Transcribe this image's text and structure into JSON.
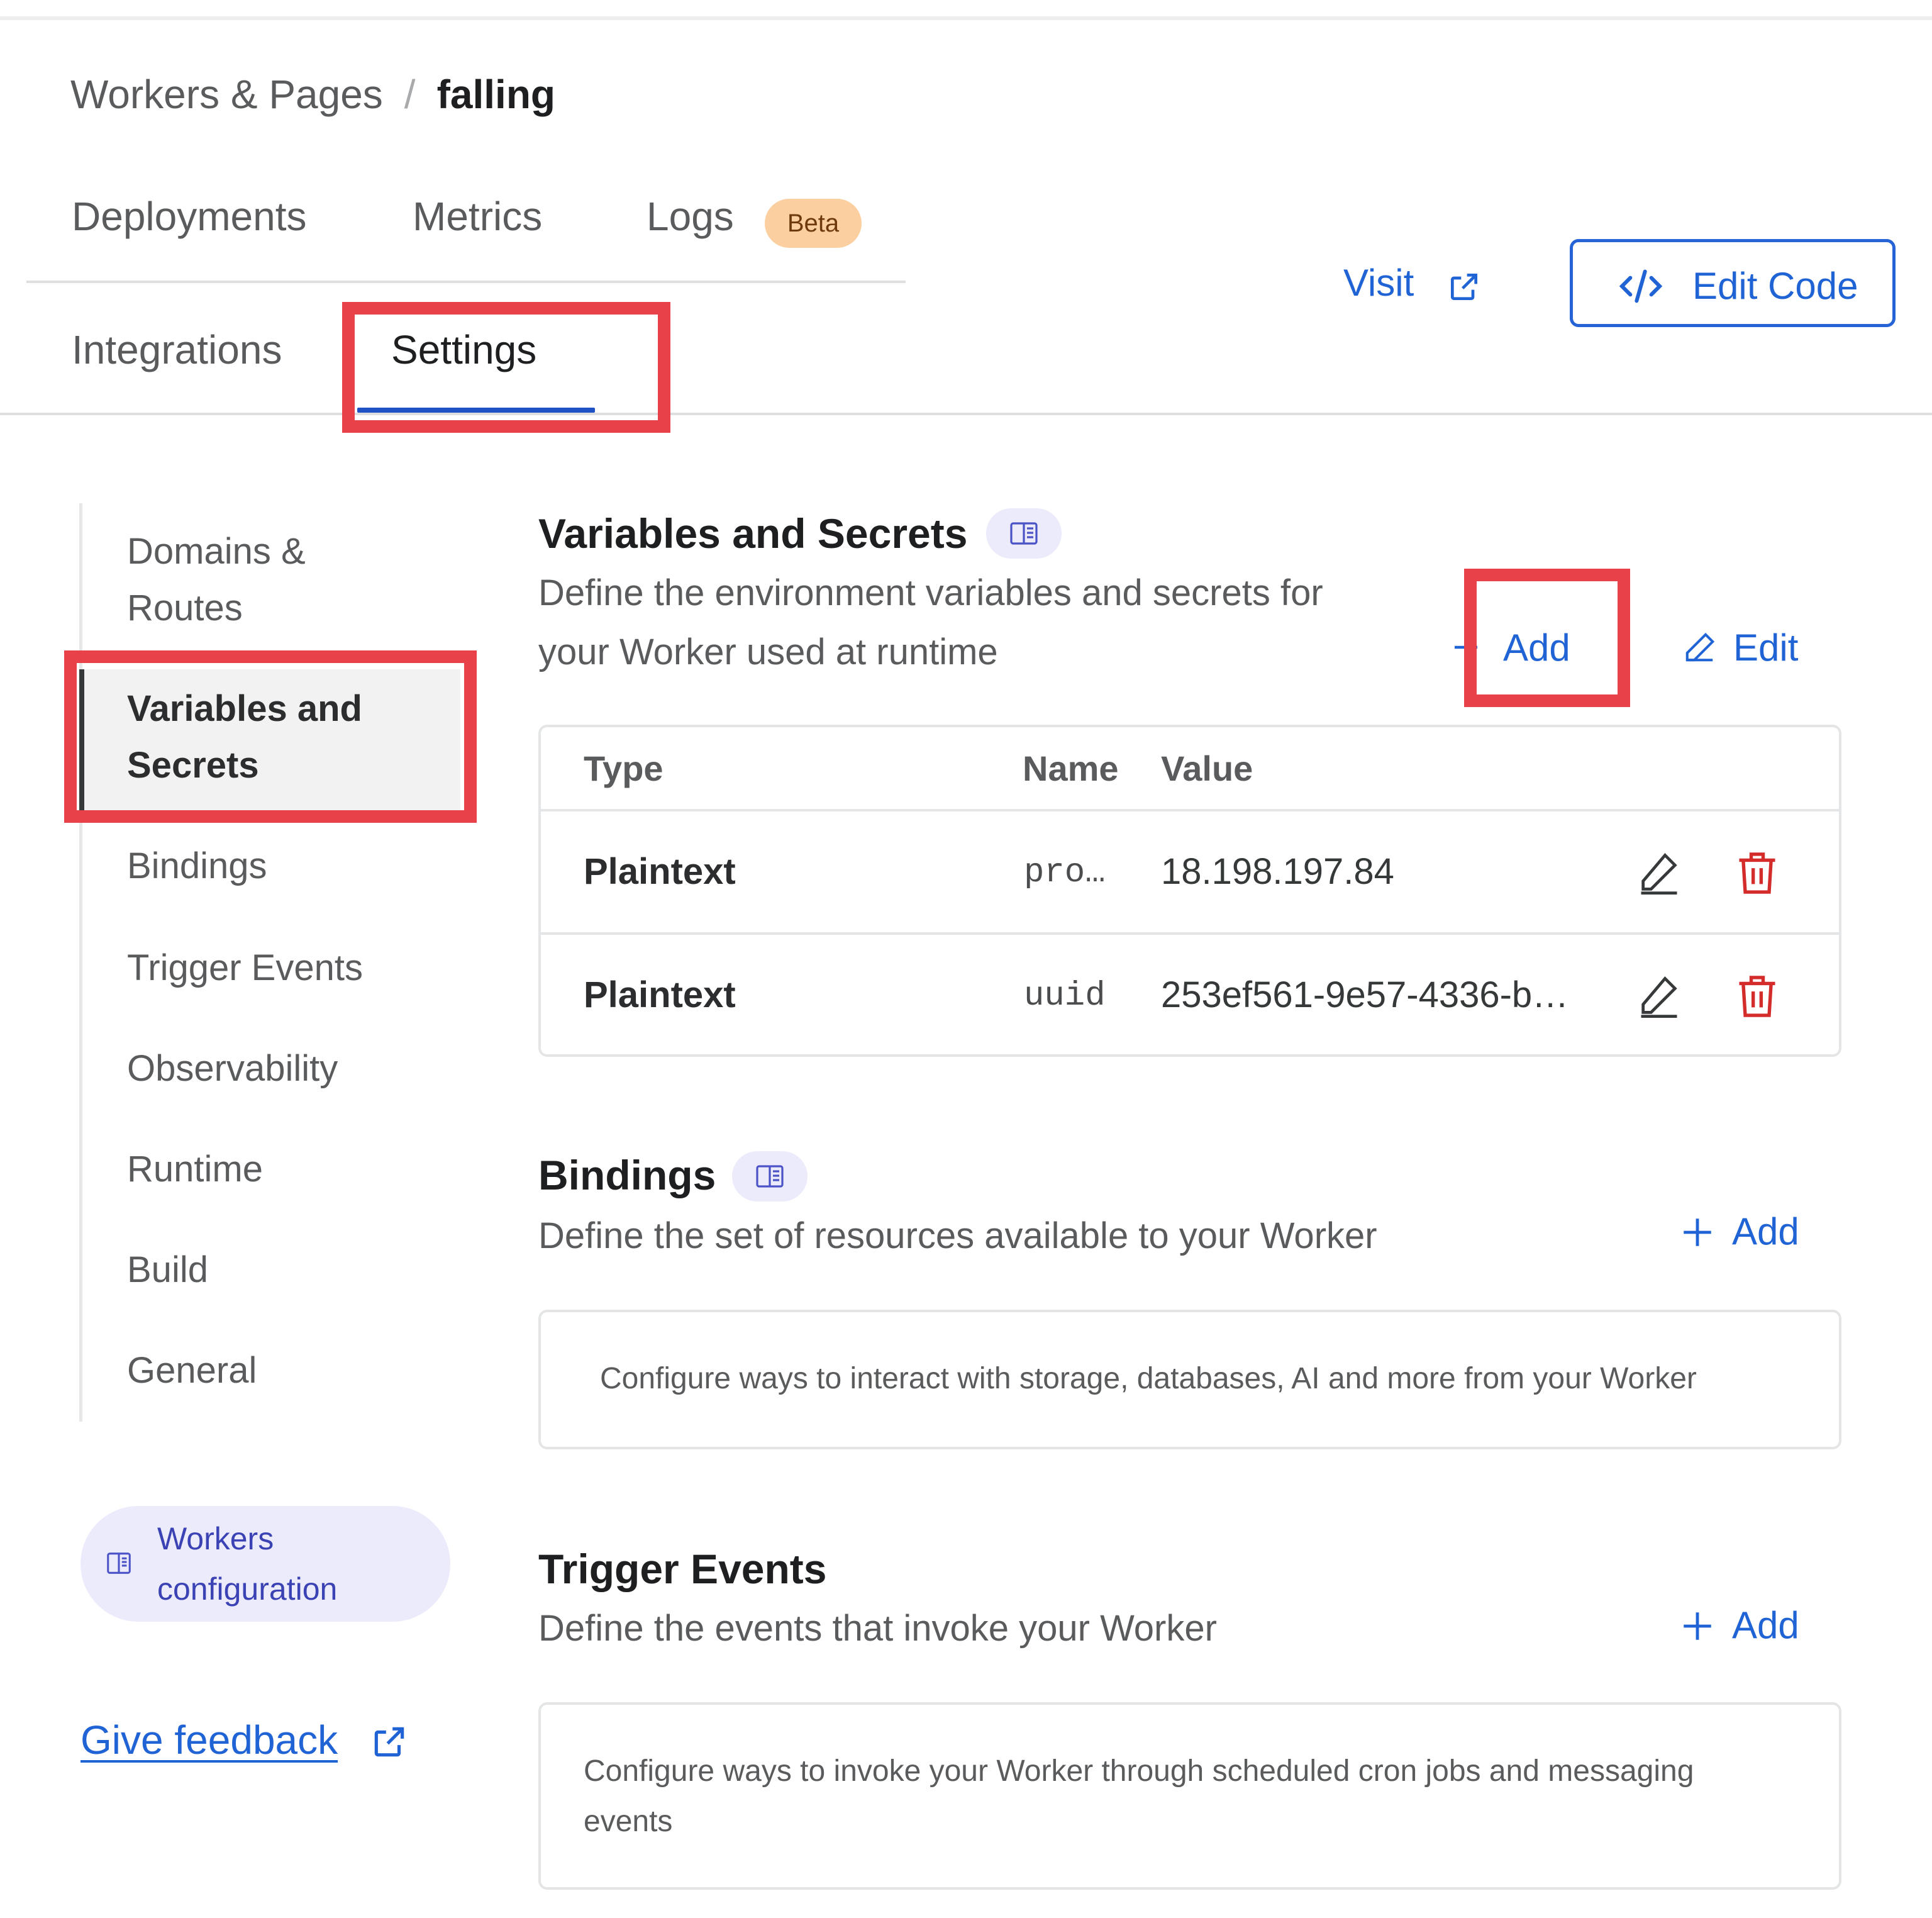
{
  "breadcrumb": {
    "parent": "Workers & Pages",
    "separator": "/",
    "current": "falling"
  },
  "tabs": {
    "row1": [
      {
        "label": "Deployments"
      },
      {
        "label": "Metrics"
      },
      {
        "label": "Logs",
        "badge": "Beta"
      }
    ],
    "row2": [
      {
        "label": "Integrations"
      },
      {
        "label": "Settings",
        "active": true
      }
    ]
  },
  "header_actions": {
    "visit": "Visit",
    "edit_code": "Edit Code"
  },
  "sidebar": {
    "items": [
      {
        "label": "Domains & Routes"
      },
      {
        "label": "Variables and Secrets",
        "active": true
      },
      {
        "label": "Bindings"
      },
      {
        "label": "Trigger Events"
      },
      {
        "label": "Observability"
      },
      {
        "label": "Runtime"
      },
      {
        "label": "Build"
      },
      {
        "label": "General"
      }
    ],
    "docs_link": "Workers configuration",
    "feedback": "Give feedback"
  },
  "variables": {
    "title": "Variables and Secrets",
    "description": "Define the environment variables and secrets for your Worker used at runtime",
    "add_label": "Add",
    "edit_label": "Edit",
    "columns": [
      "Type",
      "Name",
      "Value"
    ],
    "rows": [
      {
        "type": "Plaintext",
        "name": "pro…",
        "value": "18.198.197.84"
      },
      {
        "type": "Plaintext",
        "name": "uuid",
        "value": "253ef561-9e57-4336-b…"
      }
    ]
  },
  "bindings": {
    "title": "Bindings",
    "description": "Define the set of resources available to your Worker",
    "add_label": "Add",
    "empty_text": "Configure ways to interact with storage, databases, AI and more from your Worker"
  },
  "trigger_events": {
    "title": "Trigger Events",
    "description": "Define the events that invoke your Worker",
    "add_label": "Add",
    "empty_text": "Configure ways to invoke your Worker through scheduled cron jobs and messaging events"
  },
  "colors": {
    "accent": "#1f63d5",
    "highlight": "#e8414a",
    "danger": "#d42b2b",
    "beta_badge": "#fbcf9f"
  }
}
